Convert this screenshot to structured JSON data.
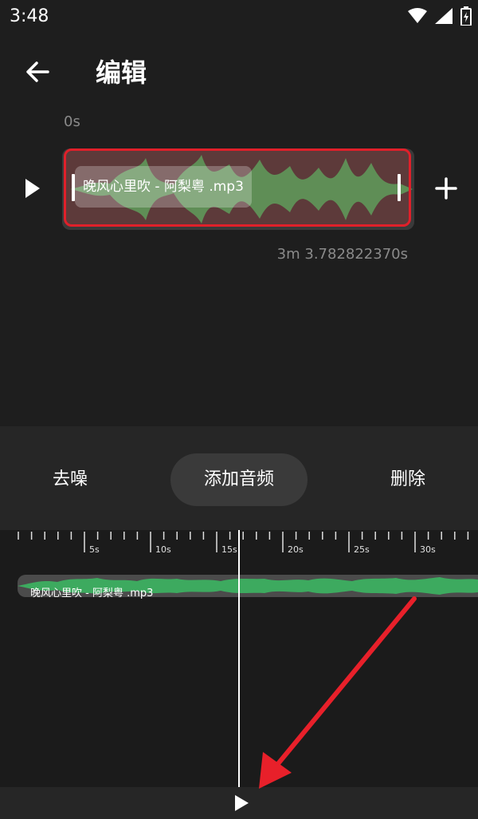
{
  "status_bar": {
    "time": "3:48",
    "icons": [
      "wifi-icon",
      "signal-icon",
      "battery-icon"
    ]
  },
  "app_bar": {
    "title": "编辑",
    "back_icon": "arrow-left-icon"
  },
  "editor": {
    "start_time": "0s",
    "clip_name": "晚风心里吹 - 阿梨粤 .mp3",
    "duration": "3m 3.782822370s",
    "play_icon": "play-icon",
    "add_icon": "plus-icon"
  },
  "tabs": [
    {
      "label": "去噪",
      "active": false
    },
    {
      "label": "添加音频",
      "active": true
    },
    {
      "label": "删除",
      "active": false
    }
  ],
  "timeline": {
    "ticks": [
      "5s",
      "10s",
      "15s",
      "20s",
      "25s",
      "30s"
    ],
    "track_name": "晚风心里吹 - 阿梨粤 .mp3"
  },
  "colors": {
    "background": "#1e1e1e",
    "waveform": "#3daa5f",
    "selection_border": "#e0202a",
    "annotation_arrow": "#e8202a"
  }
}
